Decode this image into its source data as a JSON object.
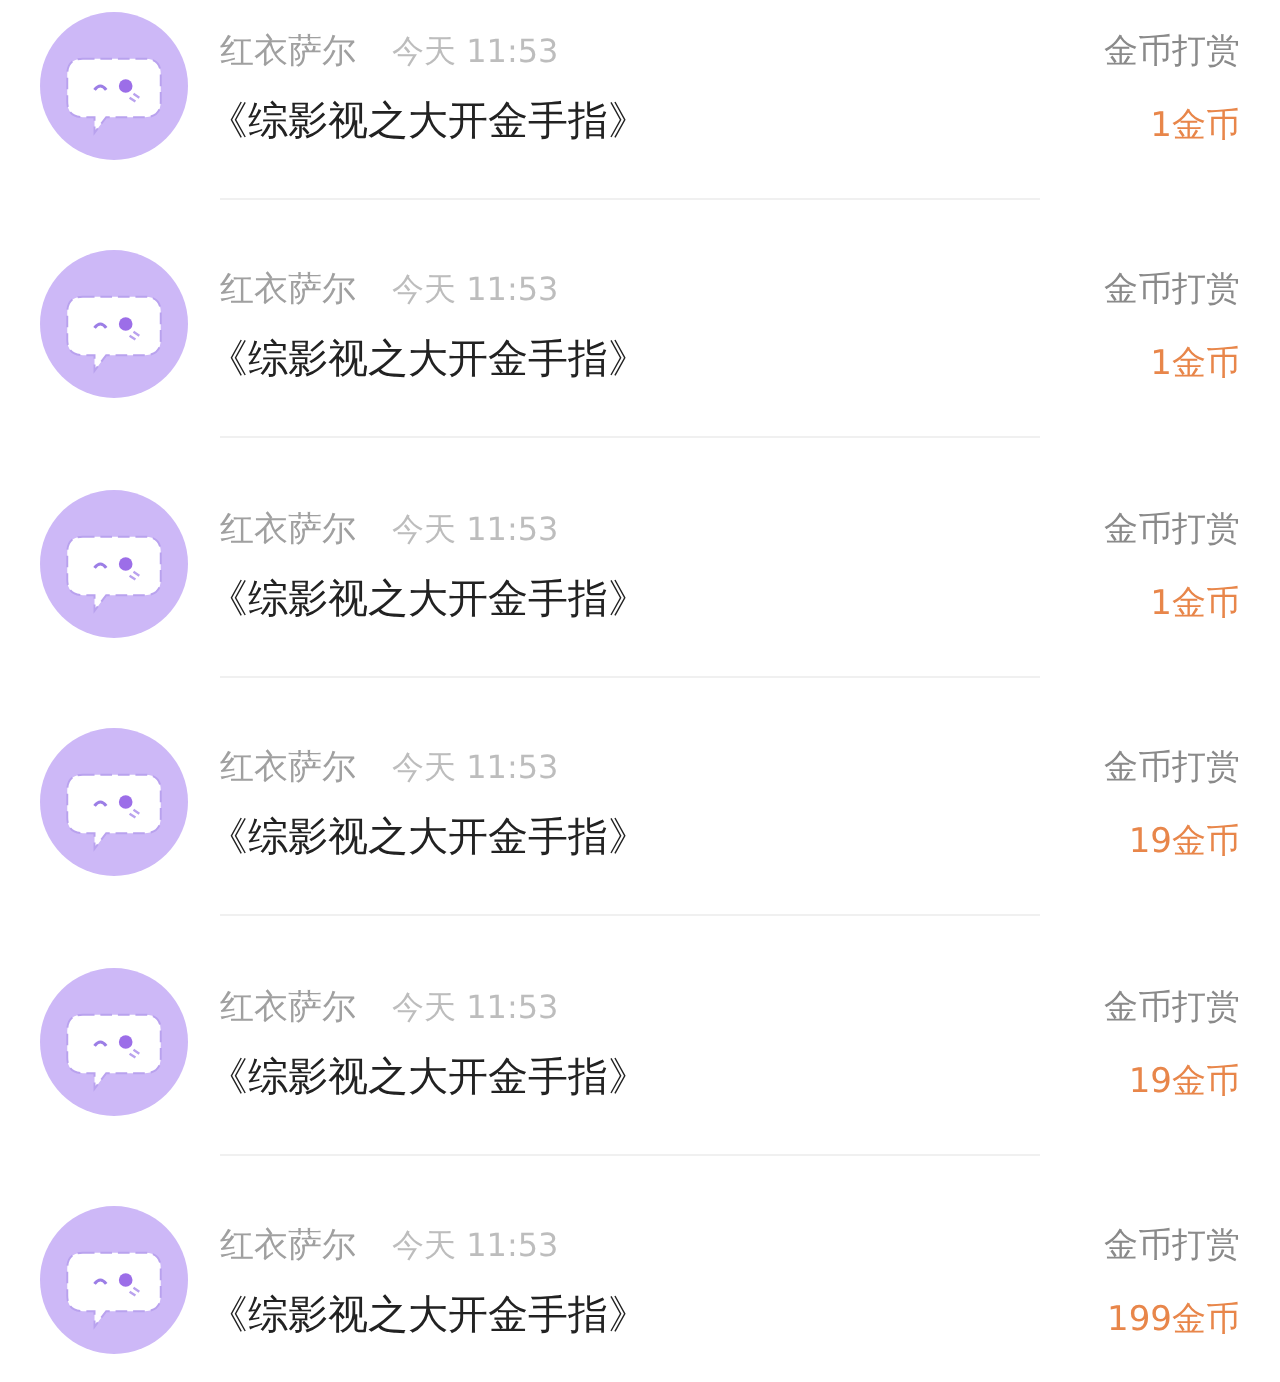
{
  "items": [
    {
      "user": "红衣萨尔",
      "time": "今天 11:53",
      "book": "《综影视之大开金手指》",
      "type": "金币打赏",
      "amount": "1金币"
    },
    {
      "user": "红衣萨尔",
      "time": "今天 11:53",
      "book": "《综影视之大开金手指》",
      "type": "金币打赏",
      "amount": "1金币"
    },
    {
      "user": "红衣萨尔",
      "time": "今天 11:53",
      "book": "《综影视之大开金手指》",
      "type": "金币打赏",
      "amount": "1金币"
    },
    {
      "user": "红衣萨尔",
      "time": "今天 11:53",
      "book": "《综影视之大开金手指》",
      "type": "金币打赏",
      "amount": "19金币"
    },
    {
      "user": "红衣萨尔",
      "time": "今天 11:53",
      "book": "《综影视之大开金手指》",
      "type": "金币打赏",
      "amount": "19金币"
    },
    {
      "user": "红衣萨尔",
      "time": "今天 11:53",
      "book": "《综影视之大开金手指》",
      "type": "金币打赏",
      "amount": "199金币"
    }
  ]
}
